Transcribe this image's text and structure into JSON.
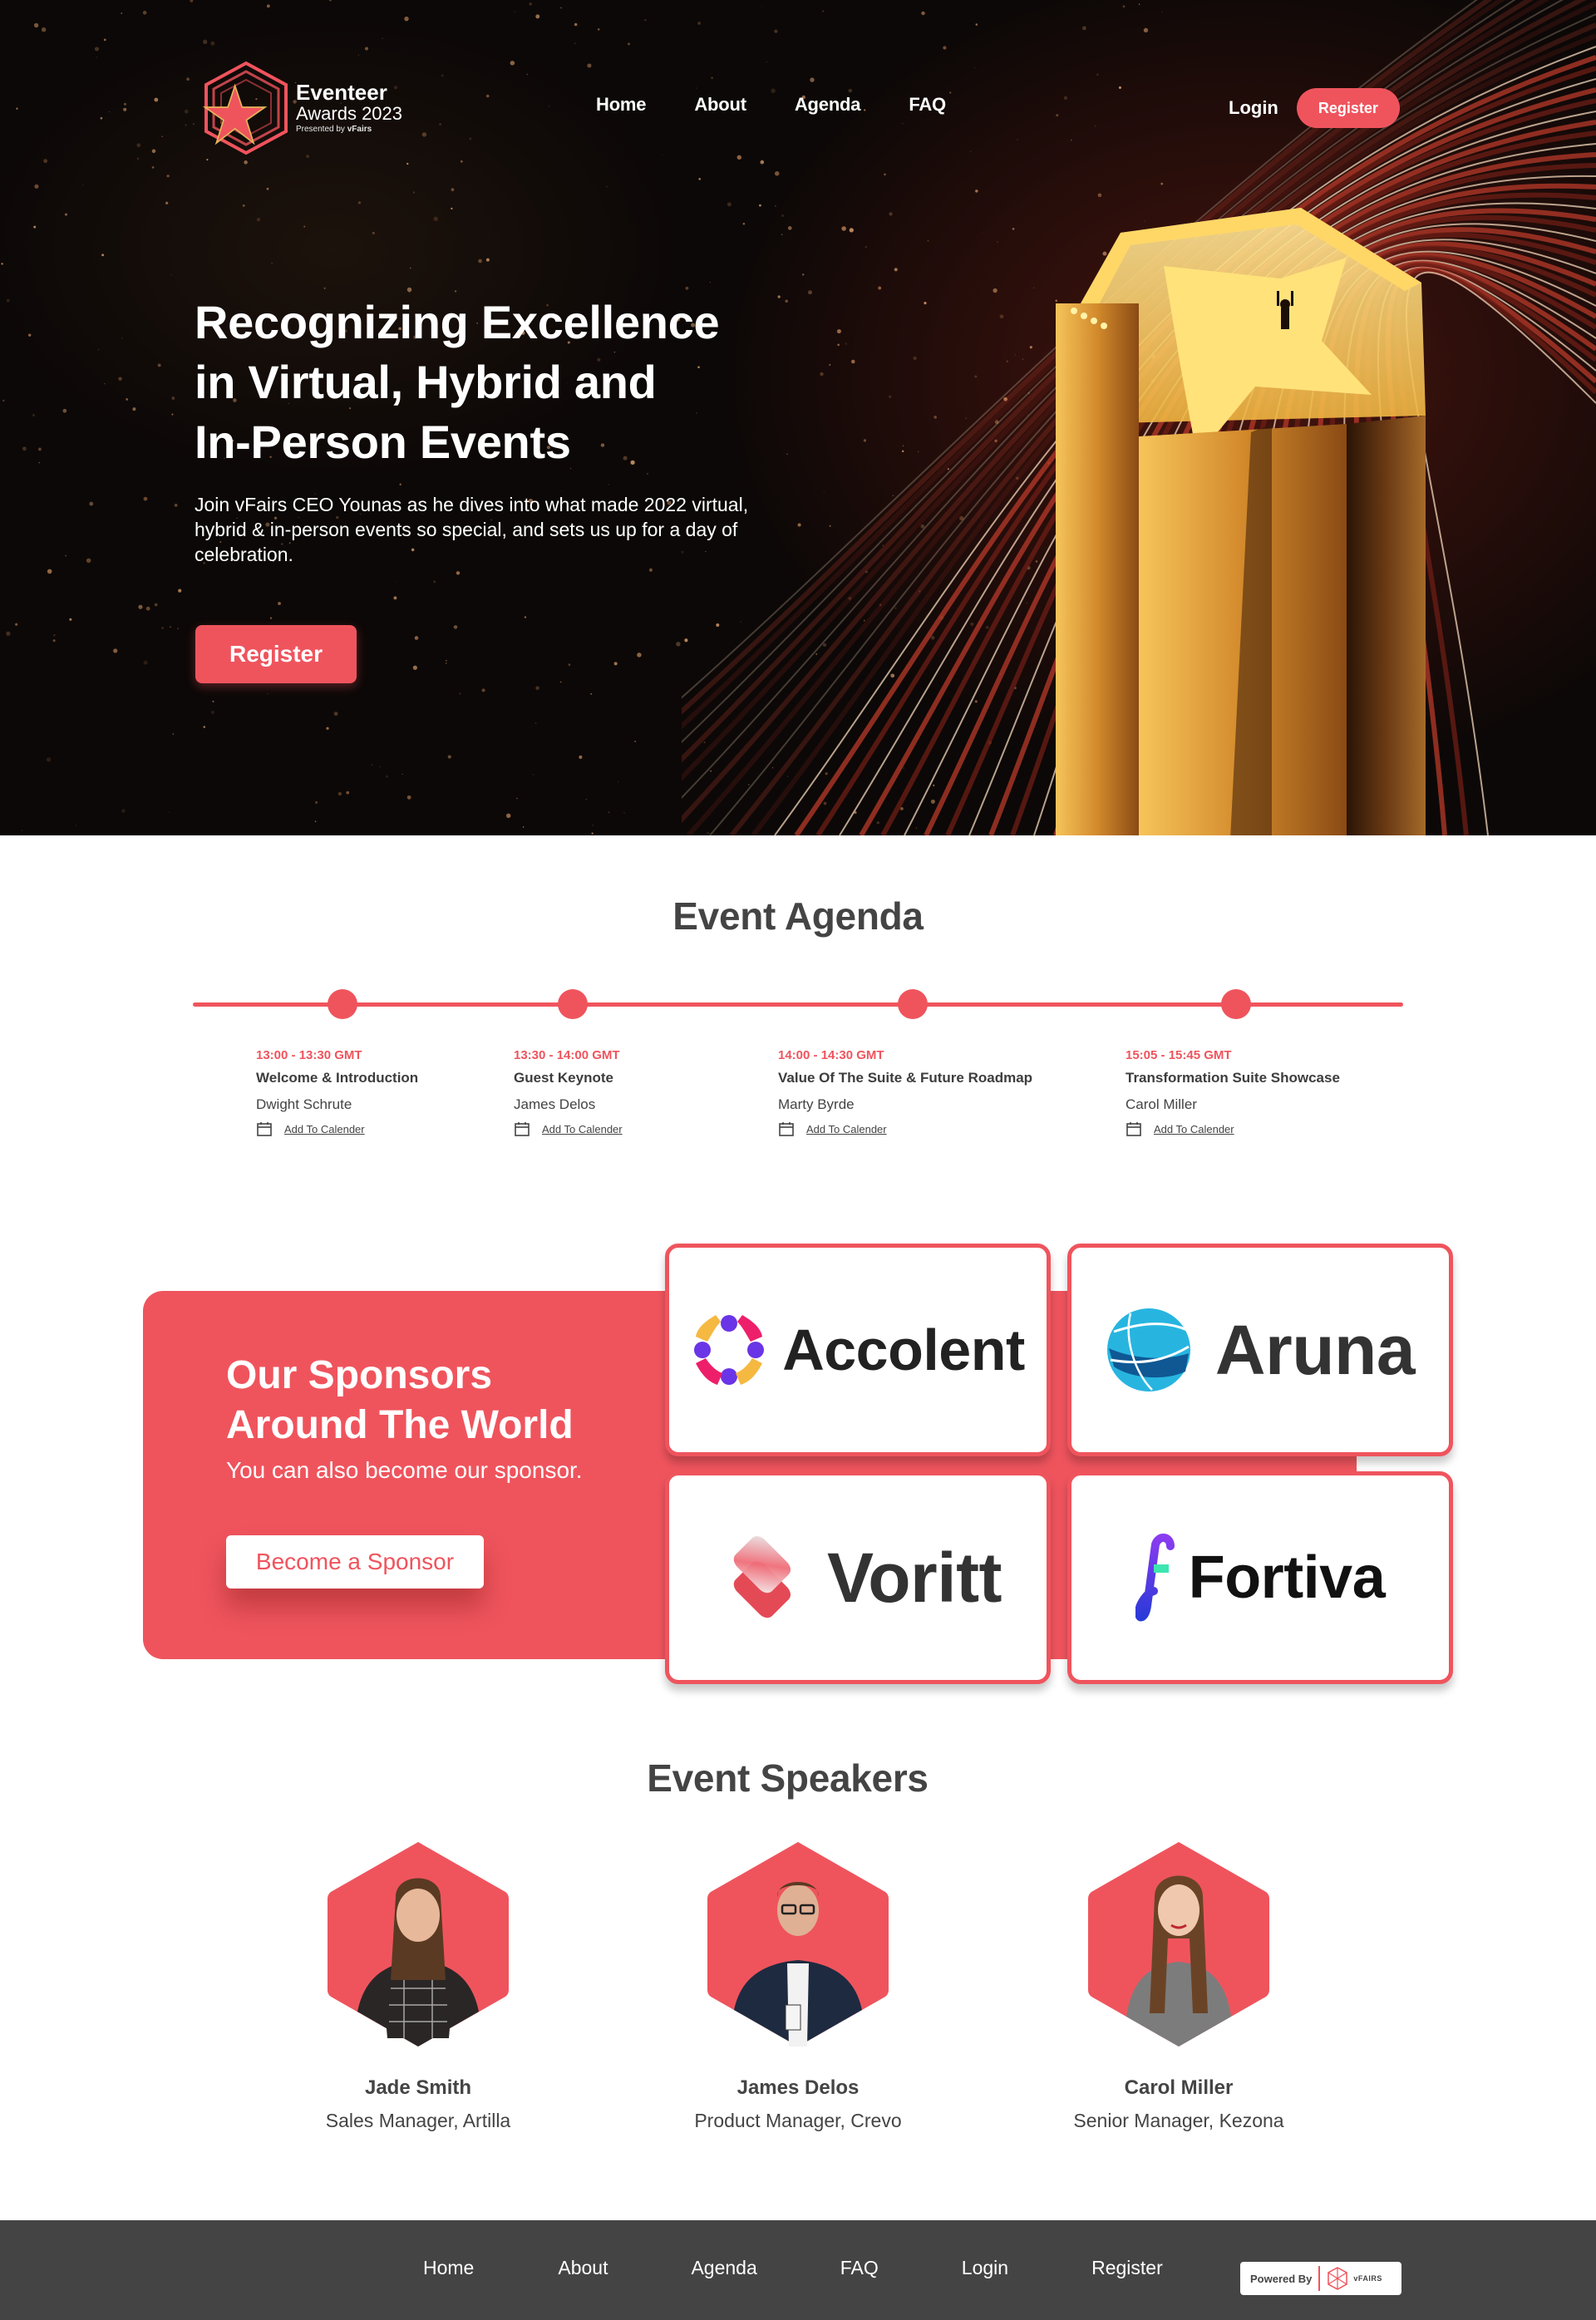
{
  "brand": {
    "title": "Eventeer",
    "subtitle": "Awards 2023",
    "presented_prefix": "Presented by ",
    "presented_brand": "vFairs",
    "accent_color": "#ef545d"
  },
  "nav": {
    "links": [
      {
        "label": "Home"
      },
      {
        "label": "About"
      },
      {
        "label": "Agenda"
      },
      {
        "label": "FAQ"
      }
    ],
    "login_label": "Login",
    "register_label": "Register"
  },
  "hero": {
    "title_lines": [
      "Recognizing Excellence",
      "in Virtual, Hybrid and",
      "In-Person Events"
    ],
    "description": "Join vFairs CEO Younas as he dives into what made 2022 virtual, hybrid & in-person events so special, and sets us up for a day of celebration.",
    "register_label": "Register"
  },
  "agenda": {
    "title": "Event Agenda",
    "calendar_link_label": "Add To Calender",
    "sessions": [
      {
        "time": "13:00 - 13:30 GMT",
        "title": "Welcome & Introduction",
        "speaker": "Dwight Schrute"
      },
      {
        "time": "13:30 - 14:00 GMT",
        "title": "Guest Keynote",
        "speaker": "James Delos"
      },
      {
        "time": "14:00 - 14:30 GMT",
        "title": "Value Of The Suite & Future Roadmap",
        "speaker": "Marty Byrde"
      },
      {
        "time": "15:05 - 15:45 GMT",
        "title": "Transformation Suite Showcase",
        "speaker": "Carol Miller"
      }
    ]
  },
  "sponsors": {
    "title_lines": [
      "Our Sponsors",
      "Around The World"
    ],
    "subtitle": "You can also become our sponsor.",
    "cta_label": "Become a Sponsor",
    "items": [
      {
        "name": "Accolent",
        "icon": "accolent-logo-icon"
      },
      {
        "name": "Aruna",
        "icon": "aruna-globe-icon"
      },
      {
        "name": "Voritt",
        "icon": "voritt-layers-icon"
      },
      {
        "name": "Fortiva",
        "icon": "fortiva-f-icon"
      }
    ]
  },
  "speakers": {
    "title": "Event Speakers",
    "items": [
      {
        "name": "Jade Smith",
        "role": "Sales Manager, Artilla"
      },
      {
        "name": "James Delos",
        "role": "Product  Manager, Crevo"
      },
      {
        "name": "Carol Miller",
        "role": "Senior Manager, Kezona"
      }
    ]
  },
  "footer": {
    "links": [
      {
        "label": "Home"
      },
      {
        "label": "About"
      },
      {
        "label": "Agenda"
      },
      {
        "label": "FAQ"
      },
      {
        "label": "Login"
      },
      {
        "label": "Register"
      }
    ],
    "powered_by_label": "Powered By",
    "powered_by_brand": "vFAIRS"
  }
}
